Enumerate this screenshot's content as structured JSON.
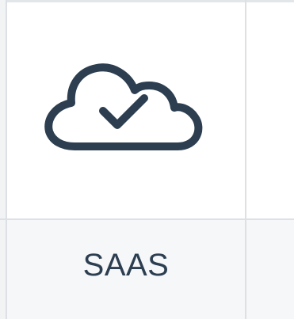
{
  "card": {
    "icon": "cloud-check-icon",
    "label": "SAAS"
  },
  "colors": {
    "icon_stroke": "#2c3e50",
    "label_text": "#2c3e50",
    "grid_line": "#dde0e4",
    "label_row_bg": "#f5f7f9"
  }
}
